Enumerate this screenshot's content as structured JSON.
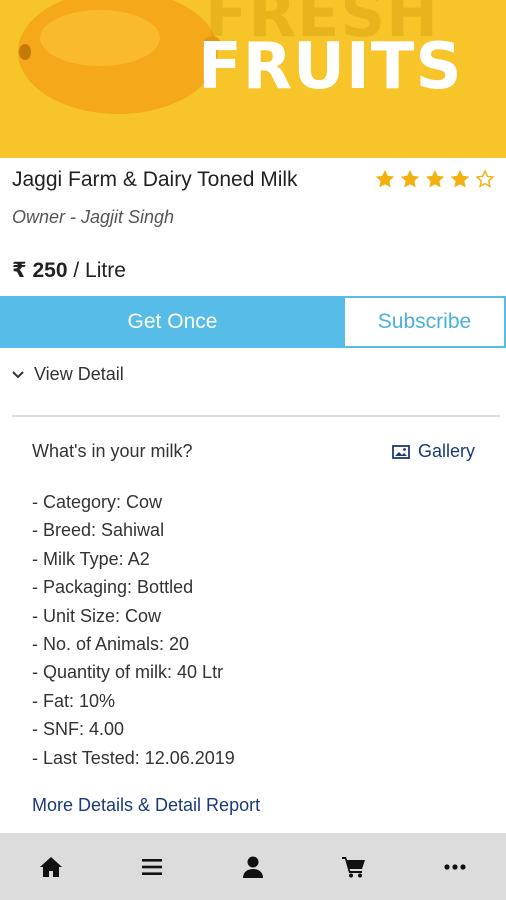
{
  "banner": {
    "line1": "FRESH",
    "line2": "FRUITS"
  },
  "product": {
    "title": "Jaggi Farm & Dairy Toned Milk",
    "rating": 4,
    "rating_max": 5,
    "owner": "Owner - Jagjit Singh",
    "currency": "₹",
    "price": "250",
    "unit": "/ Litre"
  },
  "actions": {
    "get_once": "Get Once",
    "subscribe": "Subscribe"
  },
  "view_detail": "View Detail",
  "section": {
    "question": "What's in your milk?",
    "gallery": "Gallery",
    "details": [
      "- Category: Cow",
      "- Breed: Sahiwal",
      "- Milk Type: A2",
      "- Packaging: Bottled",
      "- Unit Size: Cow",
      "- No. of Animals: 20",
      "- Quantity of milk: 40 Ltr",
      "- Fat: 10%",
      "- SNF: 4.00",
      "- Last Tested: 12.06.2019"
    ],
    "more_link": "More Details & Detail Report"
  },
  "nav": {
    "items": [
      "home-icon",
      "menu-icon",
      "user-icon",
      "cart-icon",
      "more-icon"
    ]
  },
  "colors": {
    "accent": "#57bde8",
    "banner": "#f7c52a",
    "star": "#f2b10f",
    "link": "#1a3a7a"
  }
}
